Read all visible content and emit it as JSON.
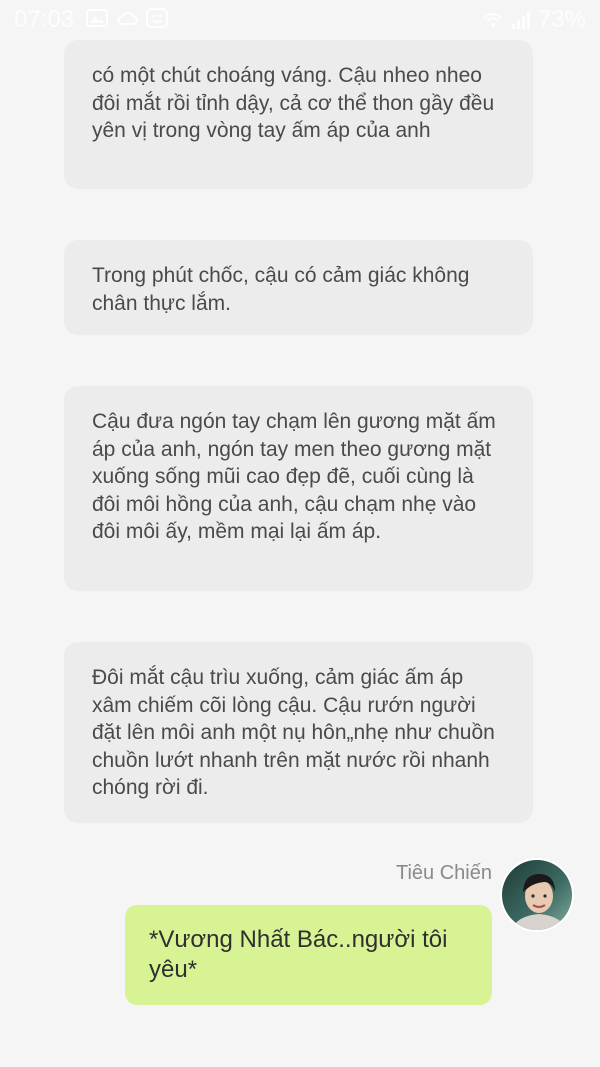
{
  "status_bar": {
    "time": "07:03",
    "battery": "73%",
    "icons_left": [
      "gallery-icon",
      "cloud-icon",
      "smile-icon"
    ],
    "icons_right": [
      "wifi-icon",
      "signal-icon"
    ]
  },
  "messages": [
    {
      "text": "có một chút choáng váng. Cậu nheo nheo đôi mắt rồi tỉnh dậy, cả cơ thể thon gầy đều yên vị trong vòng tay ấm áp của anh"
    },
    {
      "text": "Trong phút chốc, cậu có cảm giác không chân thực lắm."
    },
    {
      "text": "Cậu đưa ngón tay chạm lên gương mặt ấm áp của anh, ngón tay men theo gương mặt xuống sống mũi cao đẹp đẽ, cuối cùng là đôi môi hồng của anh, cậu chạm nhẹ vào đôi môi ấy, mềm mại lại ấm áp."
    },
    {
      "text": "Đôi mắt cậu trìu xuống, cảm giác ấm áp xâm chiếm cõi lòng cậu. Cậu rướn người đặt lên môi anh một nụ hôn„nhẹ như chuồn chuồn lướt nhanh trên mặt nước rồi nhanh chóng rời đi."
    }
  ],
  "reply": {
    "sender": "Tiêu Chiến",
    "text": "*Vương Nhất Bác..người tôi yêu*"
  },
  "colors": {
    "background": "#f5f5f5",
    "gray_bubble": "#ececec",
    "green_bubble": "#d8f393"
  }
}
